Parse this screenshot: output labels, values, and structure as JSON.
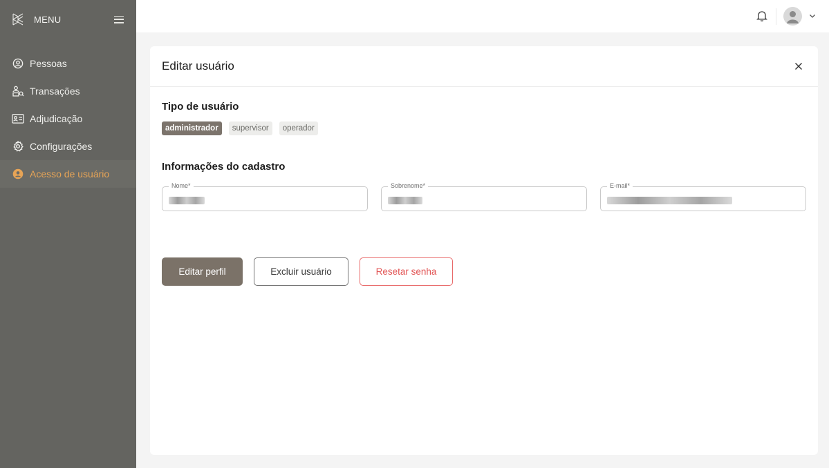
{
  "sidebar": {
    "menu_label": "MENU",
    "items": [
      {
        "label": "Pessoas",
        "icon": "person-circle-icon"
      },
      {
        "label": "Transações",
        "icon": "transactions-icon"
      },
      {
        "label": "Adjudicação",
        "icon": "id-card-icon"
      },
      {
        "label": "Configurações",
        "icon": "gear-icon"
      },
      {
        "label": "Acesso de usuário",
        "icon": "user-access-icon",
        "active": true
      }
    ]
  },
  "colors": {
    "sidebar_bg": "#646460",
    "active_accent": "#e7a456",
    "primary_button": "#7b7268",
    "danger": "#e25656"
  },
  "modal": {
    "title": "Editar usuário",
    "user_type": {
      "title": "Tipo de usuário",
      "options": [
        "administrador",
        "supervisor",
        "operador"
      ],
      "selected": "administrador"
    },
    "info": {
      "title": "Informações do cadastro",
      "fields": [
        {
          "label": "Nome*"
        },
        {
          "label": "Sobrenome*"
        },
        {
          "label": "E-mail*"
        }
      ]
    },
    "buttons": {
      "edit": "Editar perfil",
      "delete": "Excluir usuário",
      "reset": "Resetar senha"
    }
  }
}
